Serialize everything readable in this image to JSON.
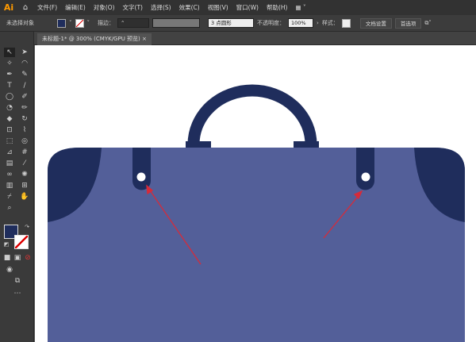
{
  "app": {
    "logo": "Ai",
    "home_icon": "home-icon"
  },
  "menu": [
    "文件(F)",
    "编辑(E)",
    "对象(O)",
    "文字(T)",
    "选择(S)",
    "效果(C)",
    "视图(V)",
    "窗口(W)",
    "帮助(H)"
  ],
  "control": {
    "selection": "未选择对象",
    "stroke_label": "描边：",
    "brush": "3 点圆形",
    "opacity_label": "不透明度：",
    "opacity": "100%",
    "style_label": "样式：",
    "doc_setup": "文档设置",
    "prefs": "首选项",
    "fill_color": "#1f2d5c"
  },
  "tab": {
    "title": "未标题-1* @ 300% (CMYK/GPU 预览)",
    "close": "×"
  },
  "colors": {
    "bag": "#535f99",
    "dark": "#1f2d5c",
    "arrow": "#d62b3a"
  }
}
